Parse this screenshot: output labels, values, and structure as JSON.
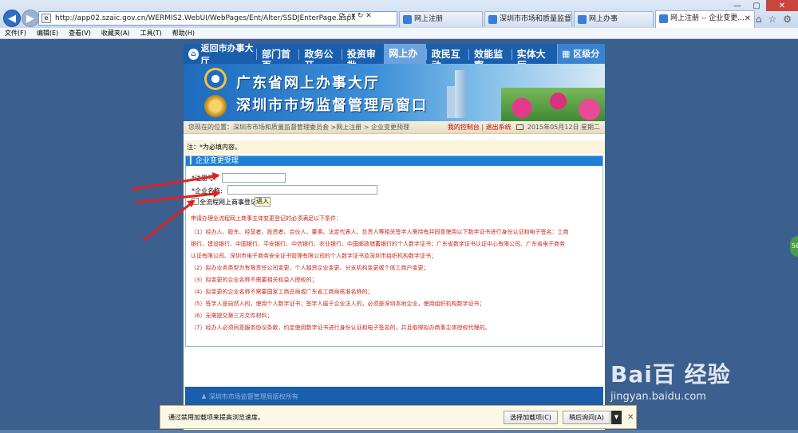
{
  "browser": {
    "url": "http://app02.szaic.gov.cn/WERMIS2.WebUI/WebPages/Ent/Alter/SSDJEnterPage.aspx",
    "tabs": [
      {
        "label": "网上注册"
      },
      {
        "label": "深圳市市场和质量监督管..."
      },
      {
        "label": "网上办事"
      },
      {
        "label": "网上注册 -- 企业变更..."
      }
    ],
    "menu": [
      "文件(F)",
      "编辑(E)",
      "查看(V)",
      "收藏夹(A)",
      "工具(T)",
      "帮助(H)"
    ]
  },
  "site": {
    "home_link": "返回市办事大厅",
    "nav": [
      "部门首页",
      "政务公开",
      "投资审批",
      "网上办事",
      "政民互动",
      "效能监察",
      "实体大厅"
    ],
    "district": "区级分厅",
    "banner_line1": "广东省网上办事大厅",
    "banner_line2": "深圳市市场监督管理局窗口",
    "breadcrumb": "您现在的位置：深圳市市场和质量监督管理委员会 >网上注册 > 企业变更预理",
    "control_panel": "我的控制台",
    "logout": "退出系统",
    "date": "2015年05月12日 星期二"
  },
  "form": {
    "note": "注：*为必填内容。",
    "panel_title": "企业变更受理",
    "reg_label": "*注册号:",
    "name_label": "*企业名称:",
    "reg_value": "",
    "name_value": "",
    "checkbox_label": "全流程网上商事登记",
    "enter_button": "进入"
  },
  "conditions": [
    "申请办理全流程网上商事主体变更登记的必须满足以下条件：",
    "（1）经办人、股东、经营者、投资者、合伙人、董事、法定代表人、负责人等相关签字人需持有并同意使用以下数字证书进行身份认证和电子签名：工商",
    "银行、建设银行、中国银行、平安银行、中信银行、农业银行、中国邮政储蓄银行的个人数字证书；广东省数字证书认证中心有限公司、广东省电子商务",
    "认证有限公司、深圳市电子商务安全证书管理有限公司的个人数字证书及深圳市组织机构数字证书；",
    "（2）拟办业务类型为有限责任公司变更、个人独资企业变更、分支机构变更或个体工商户变更；",
    "（3）拟变更的企业名称不需要相关权益人授权的；",
    "（4）拟变更的企业名称不需要国家工商总局或广东省工商局核准名称的；",
    "（5）签字人是自然人的，使用个人数字证书；签字人属于企业法人的，必须是深圳本地企业，使用组织机构数字证书；",
    "（6）无需提交第三方文件材料；",
    "（7）经办人必须同意服务协议条款，约定使用数字证书进行身份认证和电子签名的，并且取得拟办商事主体授权代理的。"
  ],
  "footer_text": "深圳市市场监督管理局版权所有",
  "notification": {
    "text": "通过禁用加载项来提高浏览速度。",
    "btn_select": "选择加载项(C)",
    "btn_later": "稍后询问(A)"
  },
  "watermark": {
    "logo": "Bai百 经验",
    "url": "jingyan.baidu.com"
  },
  "colors": {
    "nav_blue": "#1a5fae",
    "panel_head": "#1f7fd6",
    "condition_red": "#c8271a",
    "desktop": "#3b5f8f"
  }
}
